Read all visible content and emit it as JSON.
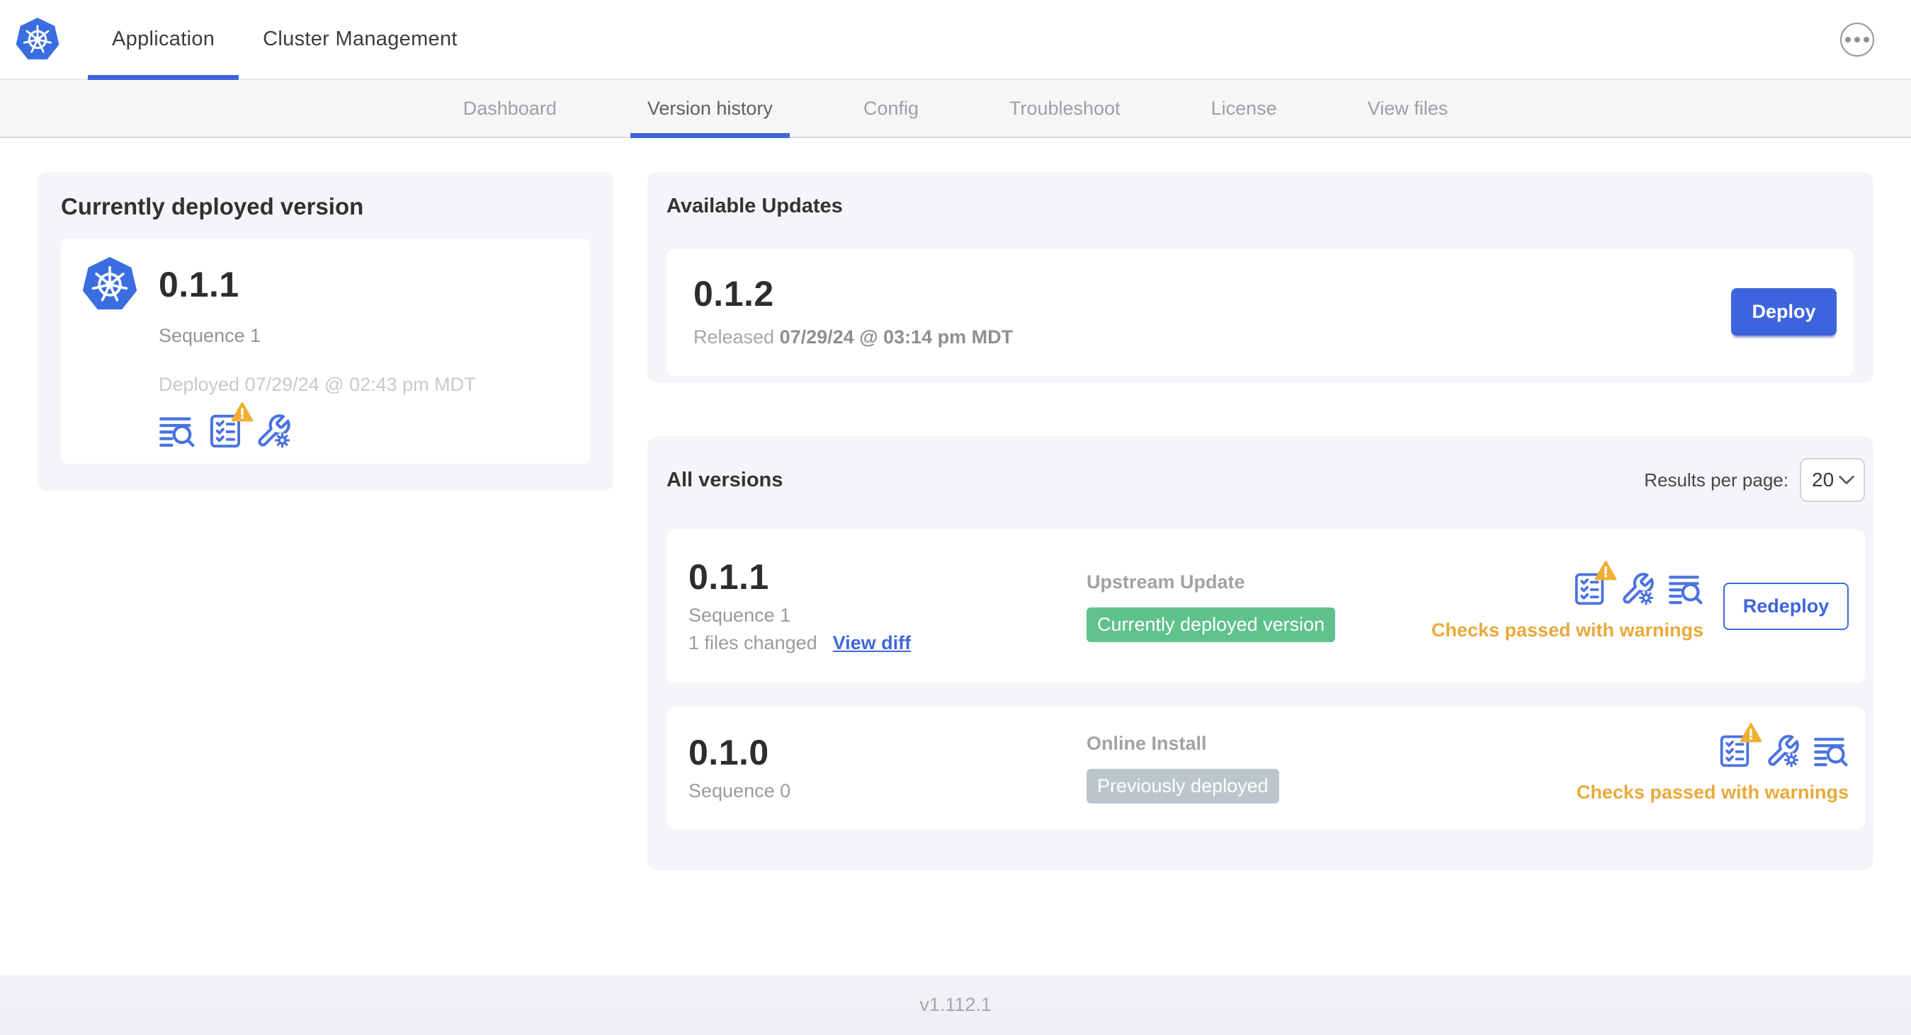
{
  "header": {
    "tabs": [
      {
        "label": "Application"
      },
      {
        "label": "Cluster Management"
      }
    ],
    "more_menu_icon": "ellipsis-icon"
  },
  "subnav": {
    "tabs": [
      {
        "label": "Dashboard"
      },
      {
        "label": "Version history",
        "active": true
      },
      {
        "label": "Config"
      },
      {
        "label": "Troubleshoot"
      },
      {
        "label": "License"
      },
      {
        "label": "View files"
      }
    ]
  },
  "currently_deployed": {
    "title": "Currently deployed version",
    "version": "0.1.1",
    "sequence": "Sequence 1",
    "deployed_at": "Deployed 07/29/24 @ 02:43 pm MDT",
    "icons": [
      "logs-icon",
      "preflight-checks-warning-icon",
      "config-icon"
    ]
  },
  "available_updates": {
    "title": "Available Updates",
    "version": "0.1.2",
    "released_label": "Released",
    "released_at": "07/29/24 @ 03:14 pm MDT",
    "deploy_button": "Deploy"
  },
  "all_versions": {
    "title": "All versions",
    "results_per_page_label": "Results per page:",
    "results_per_page_value": "20",
    "rows": [
      {
        "version": "0.1.1",
        "sequence": "Sequence 1",
        "files_changed": "1 files changed",
        "view_diff_link": "View diff",
        "source": "Upstream Update",
        "status_badge": "Currently deployed version",
        "badge_color": "#5fc18c",
        "icons": [
          "preflight-checks-warning-icon",
          "config-icon",
          "logs-icon"
        ],
        "checks_status": "Checks passed with warnings",
        "action_button": "Redeploy"
      },
      {
        "version": "0.1.0",
        "sequence": "Sequence 0",
        "source": "Online Install",
        "status_badge": "Previously deployed",
        "badge_color": "#bcc6ca",
        "icons": [
          "preflight-checks-warning-icon",
          "config-icon",
          "logs-icon"
        ],
        "checks_status": "Checks passed with warnings"
      }
    ]
  },
  "footer": {
    "app_version": "v1.112.1"
  },
  "colors": {
    "accent_blue": "#3d64dd",
    "icon_blue": "#4a72e0",
    "kubernetes_blue": "#3a6de0",
    "badge_green": "#5fc18c",
    "badge_gray": "#bcc6ca",
    "warning_orange": "#e9a93b"
  }
}
